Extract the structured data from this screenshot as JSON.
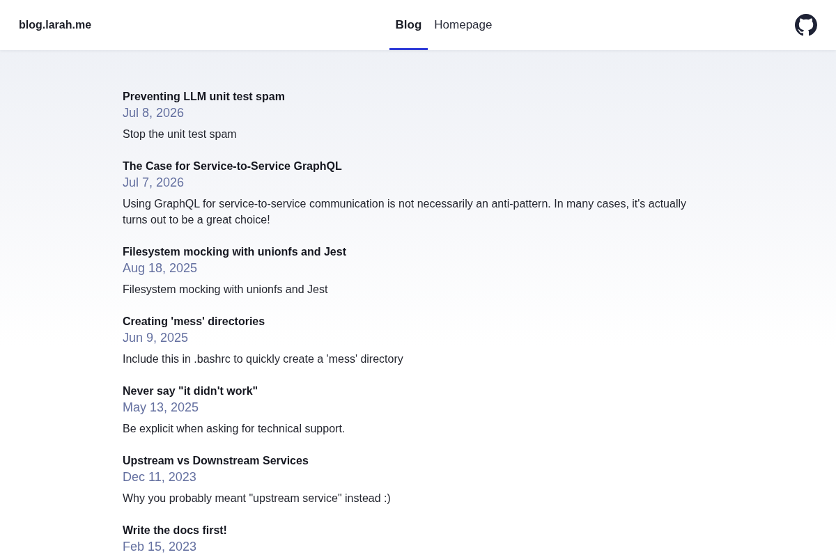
{
  "site": {
    "title": "blog.larah.me"
  },
  "nav": [
    {
      "label": "Blog",
      "selected": true
    },
    {
      "label": "Homepage",
      "selected": false
    }
  ],
  "posts": [
    {
      "title": "Preventing LLM unit test spam",
      "date": "Jul 8, 2026",
      "description": "Stop the unit test spam"
    },
    {
      "title": "The Case for Service-to-Service GraphQL",
      "date": "Jul 7, 2026",
      "description": "Using GraphQL for service-to-service communication is not necessarily an anti-pattern. In many cases, it's actually turns out to be a great choice!"
    },
    {
      "title": "Filesystem mocking with unionfs and Jest",
      "date": "Aug 18, 2025",
      "description": "Filesystem mocking with unionfs and Jest"
    },
    {
      "title": "Creating 'mess' directories",
      "date": "Jun 9, 2025",
      "description": "Include this in .bashrc to quickly create a 'mess' directory"
    },
    {
      "title": "Never say \"it didn't work\"",
      "date": "May 13, 2025",
      "description": "Be explicit when asking for technical support."
    },
    {
      "title": "Upstream vs Downstream Services",
      "date": "Dec 11, 2023",
      "description": "Why you probably meant \"upstream service\" instead :)"
    },
    {
      "title": "Write the docs first!",
      "date": "Feb 15, 2023"
    }
  ]
}
